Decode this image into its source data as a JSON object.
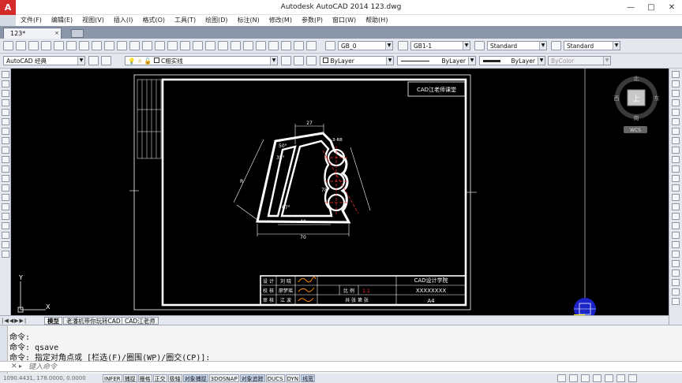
{
  "window": {
    "logo": "A",
    "title": "Autodesk AutoCAD 2014     123.dwg",
    "controls": [
      "—",
      "□",
      "✕"
    ]
  },
  "menu": [
    "文件(F)",
    "编辑(E)",
    "视图(V)",
    "插入(I)",
    "格式(O)",
    "工具(T)",
    "绘图(D)",
    "标注(N)",
    "修改(M)",
    "参数(P)",
    "窗口(W)",
    "帮助(H)"
  ],
  "tabs": {
    "document": "123*",
    "close": "×"
  },
  "toolbar1": {
    "text_style": "GB_0",
    "dim_style": "GB1-1",
    "table_style": "Standard",
    "multileader_style": "Standard"
  },
  "toolbar2": {
    "workspace": "AutoCAD 经典",
    "layer": "C粗实线",
    "color": "ByLayer",
    "linetype": "ByLayer",
    "lineweight": "ByLayer",
    "plotstyle": "ByColor"
  },
  "viewcube": {
    "north": "北",
    "south": "南",
    "east": "东",
    "west": "西",
    "face": "上",
    "wcs": "WCS"
  },
  "drawing": {
    "frame_label": "CAD江老师课堂",
    "dims": {
      "top": "27",
      "bottom_inner": "40",
      "bottom_outer": "70",
      "left_slant": "R",
      "angle1": "50°",
      "angle2": "35°",
      "angle3": "67°",
      "angle4": "78°",
      "radius": "3-R8"
    },
    "title_block": {
      "designer_label": "设 计",
      "designer": "刘 晓",
      "checker_label": "校 核",
      "checker": "廖梦瑶",
      "approver_label": "审 核",
      "approver": "江 波",
      "scale_label": "比 例",
      "scale": "1:1",
      "school": "CAD设计学院",
      "drawing_no": "XXXXXXXX",
      "footer": "共  张  第  张",
      "paper": "A4"
    }
  },
  "ucs": {
    "y": "Y",
    "x": "X"
  },
  "layout_tabs": [
    "模型",
    "老潘机带你玩转CAD",
    "CAD江老师"
  ],
  "command": {
    "lines": [
      "命令:",
      "命令:   qsave",
      "命令: 指定对角点或 [栏选(F)/圈围(WP)/圈交(CP)]:"
    ],
    "placeholder": "键入命令"
  },
  "status": {
    "coords": "1090.4431, 178.0000, 0.0000",
    "buttons": [
      {
        "label": "INFER",
        "on": false
      },
      {
        "label": "捕捉",
        "on": false
      },
      {
        "label": "栅格",
        "on": false
      },
      {
        "label": "正交",
        "on": false
      },
      {
        "label": "极轴",
        "on": false
      },
      {
        "label": "对象捕捉",
        "on": true
      },
      {
        "label": "3DOSNAP",
        "on": false
      },
      {
        "label": "对象追踪",
        "on": true
      },
      {
        "label": "DUCS",
        "on": false
      },
      {
        "label": "DYN",
        "on": false
      },
      {
        "label": "线宽",
        "on": true
      }
    ]
  }
}
